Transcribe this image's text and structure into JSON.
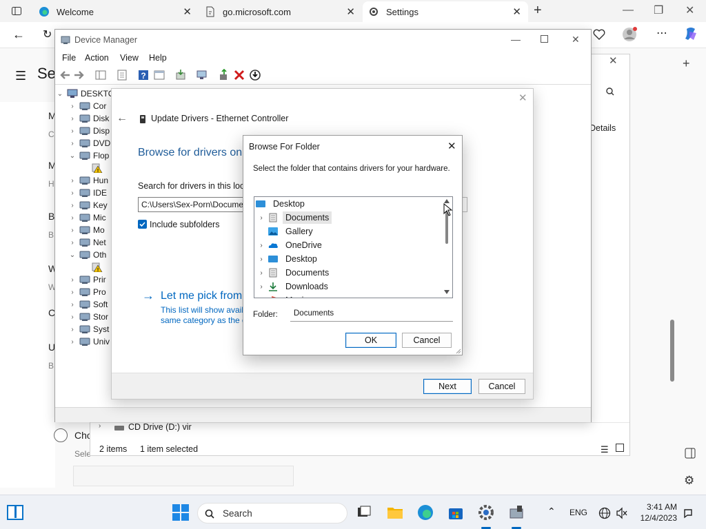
{
  "browser": {
    "tabs": [
      {
        "title": "Welcome"
      },
      {
        "title": "go.microsoft.com"
      },
      {
        "title": "Settings"
      }
    ],
    "new_tab": "+"
  },
  "settings_page": {
    "title_fragment": "Se",
    "search_icon": "search-icon",
    "details_label": "Details",
    "sections": [
      {
        "letter": "M",
        "sub": "C"
      },
      {
        "letter": "M",
        "sub": "H"
      },
      {
        "letter": "B",
        "sub": "B"
      },
      {
        "letter": "W",
        "sub": "W"
      },
      {
        "letter": "C",
        "sub": ""
      },
      {
        "letter": "U",
        "sub": "B"
      }
    ],
    "radio_label": "Cho",
    "select_label": "Sele"
  },
  "explorer": {
    "cd_drive": "CD Drive (D:) vir",
    "status_items": "2 items",
    "status_selected": "1 item selected"
  },
  "device_manager": {
    "title": "Device Manager",
    "menu": [
      "File",
      "Action",
      "View",
      "Help"
    ],
    "root": "DESKTO",
    "tree": [
      {
        "label": "Cor",
        "expanded": false,
        "icon": "monitor-icon"
      },
      {
        "label": "Disk",
        "expanded": false,
        "icon": "disk-icon"
      },
      {
        "label": "Disp",
        "expanded": false,
        "icon": "display-icon"
      },
      {
        "label": "DVD",
        "expanded": false,
        "icon": "dvd-icon"
      },
      {
        "label": "Flop",
        "expanded": true,
        "icon": "floppy-icon"
      },
      {
        "label": "",
        "child": true,
        "icon": "warning-device-icon"
      },
      {
        "label": "Hun",
        "expanded": false,
        "icon": "hid-icon"
      },
      {
        "label": "IDE",
        "expanded": false,
        "icon": "ide-icon"
      },
      {
        "label": "Key",
        "expanded": false,
        "icon": "keyboard-icon"
      },
      {
        "label": "Mic",
        "expanded": false,
        "icon": "mouse-icon"
      },
      {
        "label": "Mo",
        "expanded": false,
        "icon": "monitor-icon"
      },
      {
        "label": "Net",
        "expanded": false,
        "icon": "network-icon"
      },
      {
        "label": "Oth",
        "expanded": true,
        "icon": "other-icon"
      },
      {
        "label": "",
        "child": true,
        "icon": "warning-device-icon"
      },
      {
        "label": "Prir",
        "expanded": false,
        "icon": "printer-icon"
      },
      {
        "label": "Pro",
        "expanded": false,
        "icon": "processor-icon"
      },
      {
        "label": "Soft",
        "expanded": false,
        "icon": "software-icon"
      },
      {
        "label": "Stor",
        "expanded": false,
        "icon": "storage-icon"
      },
      {
        "label": "Syst",
        "expanded": false,
        "icon": "system-icon"
      },
      {
        "label": "Univ",
        "expanded": false,
        "icon": "usb-icon"
      }
    ]
  },
  "wizard": {
    "title": "Update Drivers - Ethernet Controller",
    "heading": "Browse for drivers on",
    "search_label": "Search for drivers in this locat",
    "path_value": "C:\\Users\\Sex-Porn\\Docume",
    "include_subfolders": "Include subfolders",
    "include_checked": true,
    "pick_link": "Let me pick from",
    "pick_desc_1": "This list will show avail",
    "pick_desc_2": "same category as the d",
    "next": "Next",
    "cancel": "Cancel"
  },
  "browse_dialog": {
    "title": "Browse For Folder",
    "instruction": "Select the folder that contains drivers for your hardware.",
    "tree": [
      {
        "label": "Desktop",
        "level": 0,
        "chevron": false,
        "icon": "desktop-folder-icon"
      },
      {
        "label": "Documents",
        "level": 1,
        "chevron": true,
        "icon": "documents-icon",
        "selected": true
      },
      {
        "label": "Gallery",
        "level": 1,
        "chevron": false,
        "icon": "gallery-icon"
      },
      {
        "label": "OneDrive",
        "level": 1,
        "chevron": true,
        "icon": "onedrive-icon"
      },
      {
        "label": "Desktop",
        "level": 1,
        "chevron": true,
        "icon": "desktop-folder-icon"
      },
      {
        "label": "Documents",
        "level": 1,
        "chevron": true,
        "icon": "documents-icon"
      },
      {
        "label": "Downloads",
        "level": 1,
        "chevron": true,
        "icon": "downloads-icon"
      },
      {
        "label": "Music",
        "level": 1,
        "chevron": true,
        "icon": "music-icon"
      }
    ],
    "folder_label": "Folder:",
    "folder_value": "Documents",
    "ok": "OK",
    "cancel": "Cancel"
  },
  "taskbar": {
    "search_placeholder": "Search",
    "language": "ENG",
    "time": "3:41 AM",
    "date": "12/4/2023"
  },
  "colors": {
    "accent": "#0067c0",
    "link": "#0067c0",
    "heading_blue": "#1f5c99"
  }
}
